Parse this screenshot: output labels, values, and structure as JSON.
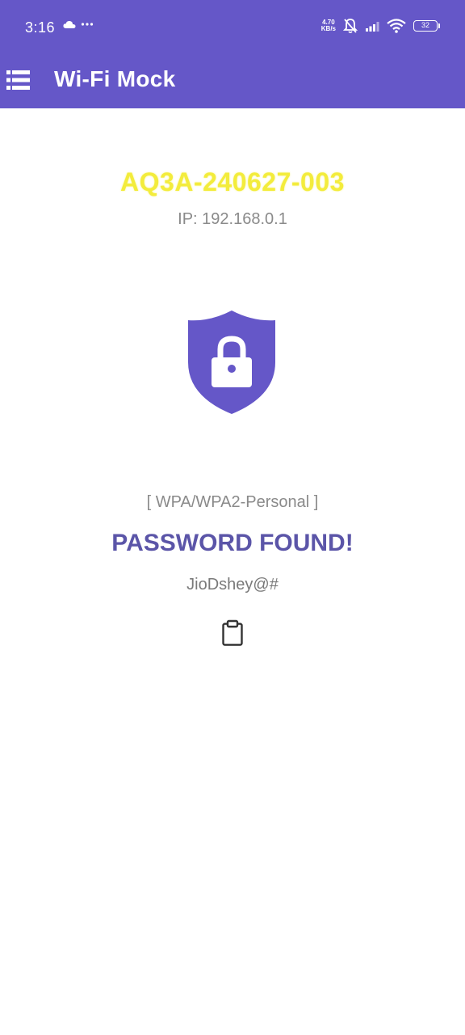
{
  "status_bar": {
    "time": "3:16",
    "left_icons": [
      "cloud-icon",
      "more-dots-icon"
    ],
    "network_speed": [
      "4.70",
      "KB/s"
    ],
    "right_icons": [
      "mute-icon",
      "signal-icon",
      "wifi-icon"
    ],
    "battery": "32"
  },
  "toolbar": {
    "menu_icon": "menu-icon",
    "title": "Wi-Fi Mock"
  },
  "network": {
    "ssid": "AQ3A-240627-003",
    "ip": "IP: 192.168.0.1",
    "security": "[ WPA/WPA2-Personal ]",
    "status": "PASSWORD FOUND!",
    "password": "JioDshey@#",
    "copy_icon": "clipboard-icon"
  },
  "colors": {
    "accent": "#6557c8",
    "ssid": "#f3ec3c",
    "headline": "#5b55a8",
    "muted_text": "#8a8a8a"
  }
}
